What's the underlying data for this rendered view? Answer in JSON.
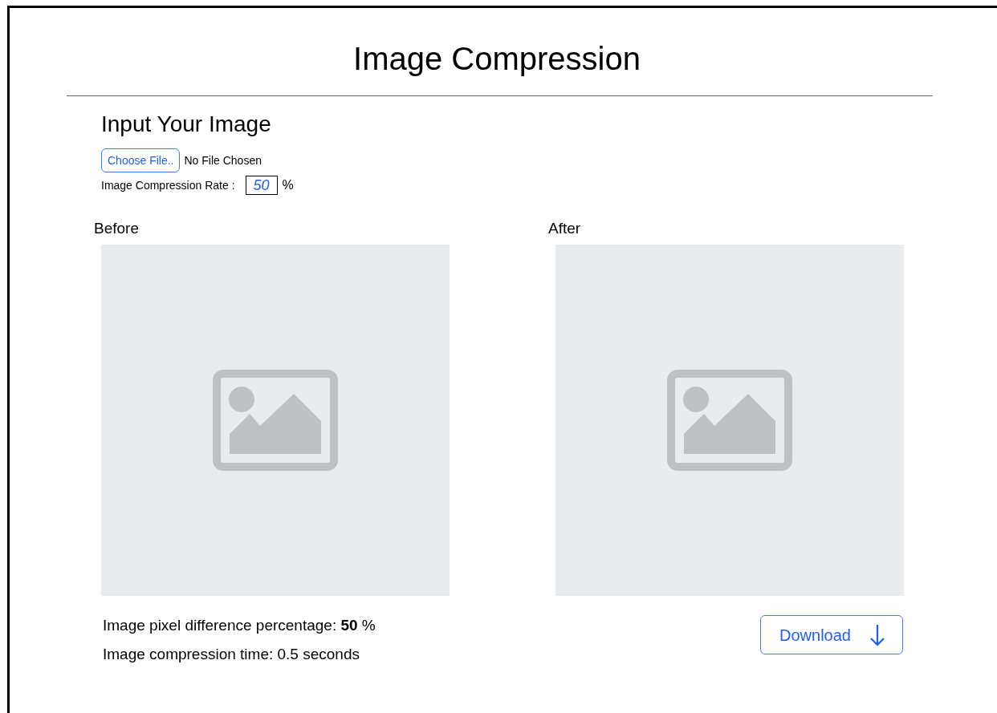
{
  "title": "Image Compression",
  "input": {
    "heading": "Input Your Image",
    "choose_button": "Choose File..",
    "file_status": "No File Chosen",
    "rate_label": "Image Compression Rate :",
    "rate_value": "50",
    "rate_unit": "%"
  },
  "panels": [
    {
      "label": "Before"
    },
    {
      "label": "After"
    }
  ],
  "stats": [
    "Image pixel difference percentage: **50** %",
    "Image compression time: 0.5 seconds"
  ],
  "download_button": "Download"
}
